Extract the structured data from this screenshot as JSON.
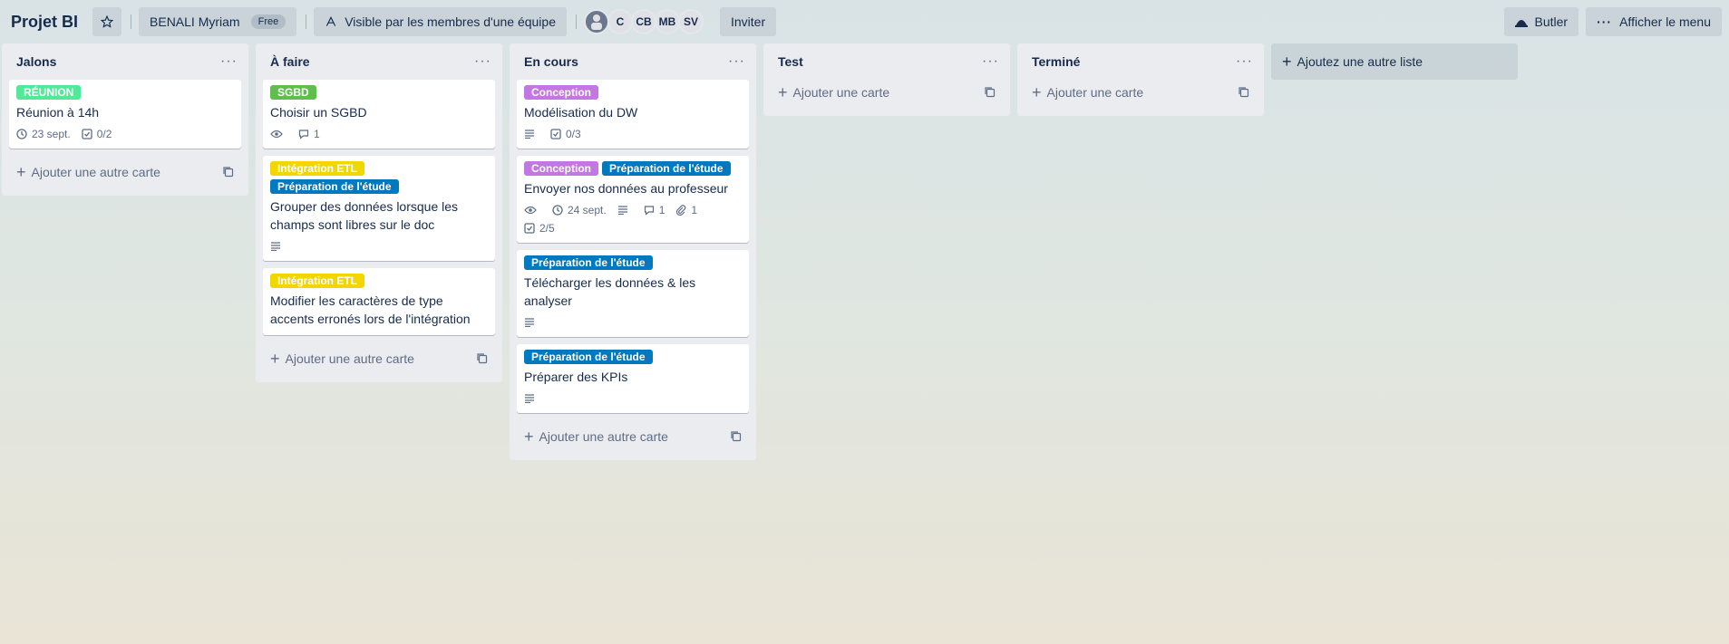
{
  "header": {
    "board_title": "Projet BI",
    "workspace": "BENALI Myriam",
    "workspace_plan": "Free",
    "visibility": "Visible par les membres d'une équipe",
    "members": [
      "C",
      "CB",
      "MB",
      "SV"
    ],
    "invite_label": "Inviter",
    "butler_label": "Butler",
    "menu_label": "Afficher le menu"
  },
  "colors": {
    "green": "#61bd4f",
    "green_light": "#51e898",
    "yellow": "#f2d600",
    "purple": "#c377e0",
    "blue": "#0079bf"
  },
  "add_card_label": "Ajouter une autre carte",
  "add_card_label_short": "Ajouter une carte",
  "add_list_label": "Ajoutez une autre liste",
  "lists": [
    {
      "title": "Jalons",
      "cards": [
        {
          "labels": [
            {
              "text": "RÉUNION",
              "color": "#51e898"
            }
          ],
          "title": "Réunion à 14h",
          "due": "23 sept.",
          "checklist": "0/2"
        }
      ]
    },
    {
      "title": "À faire",
      "cards": [
        {
          "labels": [
            {
              "text": "SGBD",
              "color": "#61bd4f"
            }
          ],
          "title": "Choisir un SGBD",
          "comments": "1"
        },
        {
          "labels": [
            {
              "text": "Intégration ETL",
              "color": "#f2d600"
            },
            {
              "text": "Préparation de l'étude",
              "color": "#0079bf"
            }
          ],
          "title": "Grouper des données lorsque les champs sont libres sur le doc"
        },
        {
          "labels": [
            {
              "text": "Intégration ETL",
              "color": "#f2d600"
            }
          ],
          "title": "Modifier les caractères de type accents erronés lors de l'intégration"
        }
      ]
    },
    {
      "title": "En cours",
      "cards": [
        {
          "labels": [
            {
              "text": "Conception",
              "color": "#c377e0"
            }
          ],
          "title": "Modélisation du DW",
          "checklist": "0/3"
        },
        {
          "labels": [
            {
              "text": "Conception",
              "color": "#c377e0"
            },
            {
              "text": "Préparation de l'étude",
              "color": "#0079bf"
            }
          ],
          "title": "Envoyer nos données au professeur",
          "due": "24 sept.",
          "comments": "1",
          "attachments": "1",
          "checklist": "2/5"
        },
        {
          "labels": [
            {
              "text": "Préparation de l'étude",
              "color": "#0079bf"
            }
          ],
          "title": "Télécharger les données & les analyser"
        },
        {
          "labels": [
            {
              "text": "Préparation de l'étude",
              "color": "#0079bf"
            }
          ],
          "title": "Préparer des KPIs"
        }
      ]
    },
    {
      "title": "Test",
      "cards": []
    },
    {
      "title": "Terminé",
      "cards": []
    }
  ]
}
